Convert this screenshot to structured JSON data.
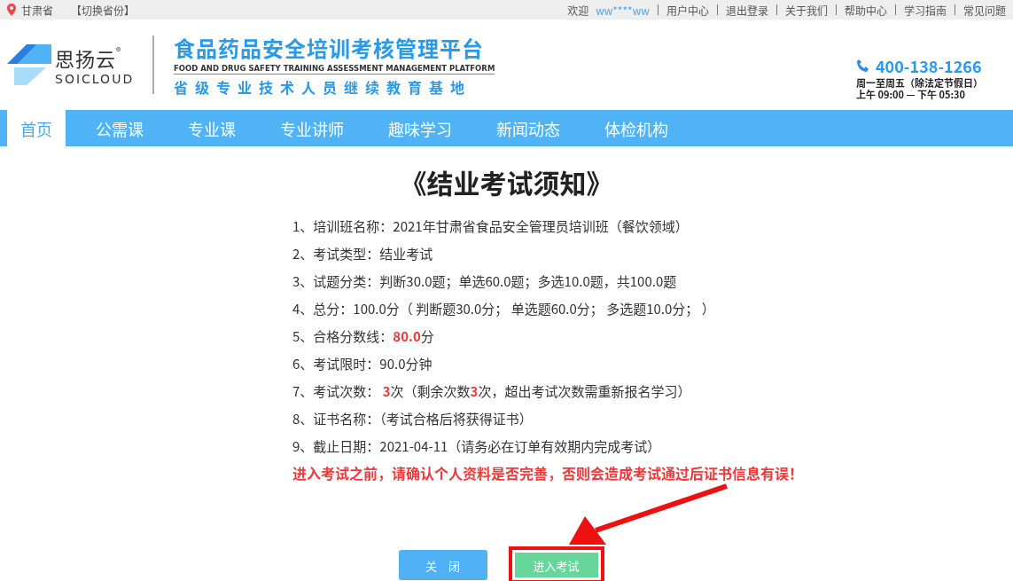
{
  "top_bar": {
    "province": "甘肃省",
    "switch_link": "【切换省份】",
    "welcome": "欢迎",
    "username": "ww****ww",
    "links": [
      "用户中心",
      "退出登录",
      "关于我们",
      "帮助中心",
      "学习指南",
      "常见问题"
    ]
  },
  "header": {
    "logo_cn": "思扬云",
    "logo_mark": "®",
    "logo_en": "SOICLOUD",
    "platform_title": "食品药品安全培训考核管理平台",
    "platform_en": "FOOD AND DRUG SAFETY TRAINING ASSESSMENT MANAGEMENT PLATFORM",
    "platform_sub": "省级专业技术人员继续教育基地",
    "phone": "400-138-1266",
    "hours_1": "周一至周五（除法定节假日）",
    "hours_2": "上午 09:00 — 下午 05:30"
  },
  "nav": [
    {
      "label": "首页",
      "selected": true
    },
    {
      "label": "公需课",
      "selected": false
    },
    {
      "label": "专业课",
      "selected": false
    },
    {
      "label": "专业讲师",
      "selected": false
    },
    {
      "label": "趣味学习",
      "selected": false
    },
    {
      "label": "新闻动态",
      "selected": false
    },
    {
      "label": "体检机构",
      "selected": false
    }
  ],
  "notice": {
    "title": "《结业考试须知》",
    "items": [
      [
        {
          "text": "1、培训班名称：2021年甘肃省食品安全管理员培训班（餐饮领域）",
          "emphasis": false
        }
      ],
      [
        {
          "text": "2、考试类型：结业考试",
          "emphasis": false
        }
      ],
      [
        {
          "text": "3、试题分类：判断30.0题；单选60.0题；多选10.0题，共100.0题",
          "emphasis": false
        }
      ],
      [
        {
          "text": "4、总分：100.0分（ 判断题30.0分； 单选题60.0分； 多选题10.0分； ）",
          "emphasis": false
        }
      ],
      [
        {
          "text": "5、合格分数线：",
          "emphasis": false
        },
        {
          "text": "80.0",
          "emphasis": true
        },
        {
          "text": "分",
          "emphasis": false
        }
      ],
      [
        {
          "text": "6、考试限时：90.0分钟",
          "emphasis": false
        }
      ],
      [
        {
          "text": "7、考试次数： ",
          "emphasis": false
        },
        {
          "text": "3",
          "emphasis": true
        },
        {
          "text": "次（剩余次数",
          "emphasis": false
        },
        {
          "text": "3",
          "emphasis": true
        },
        {
          "text": "次，超出考试次数需重新报名学习）",
          "emphasis": false
        }
      ],
      [
        {
          "text": "8、证书名称：（考试合格后将获得证书）",
          "emphasis": false
        }
      ],
      [
        {
          "text": "9、截止日期：2021-04-11（请务必在订单有效期内完成考试）",
          "emphasis": false
        }
      ]
    ],
    "warning": "进入考试之前，请确认个人资料是否完善，否则会造成考试通过后证书信息有误！"
  },
  "buttons": [
    {
      "label": "关　闭",
      "kind": "close",
      "highlighted": false
    },
    {
      "label": "进入考试",
      "kind": "enter",
      "highlighted": true
    }
  ]
}
